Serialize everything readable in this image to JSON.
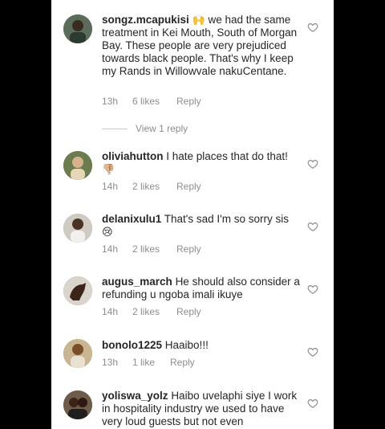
{
  "comments": [
    {
      "username": "songz.mcapukisi",
      "emoji": "🙌",
      "text": "we had the same treatment in Kei Mouth, South of Morgan Bay. These people are very prejudiced towards black people. That's why I keep my Rands in Willowvale nakuCentane.",
      "time": "13h",
      "likes": "6 likes",
      "reply": "Reply"
    },
    {
      "username": "oliviahutton",
      "text": "I hate places that do that!",
      "emoji": "👎🏼",
      "time": "14h",
      "likes": "2 likes",
      "reply": "Reply"
    },
    {
      "username": "delanixulu1",
      "text": "That's sad I'm so sorry sis",
      "emoji": "😢",
      "time": "14h",
      "likes": "2 likes",
      "reply": "Reply"
    },
    {
      "username": "augus_march",
      "text": "He should also consider a refunding u ngoba imali ikuye",
      "time": "14h",
      "likes": "2 likes",
      "reply": "Reply"
    },
    {
      "username": "bonolo1225",
      "text": "Haaibo!!!",
      "time": "13h",
      "likes": "1 like",
      "reply": "Reply"
    },
    {
      "username": "yoliswa_yolz",
      "text": "Haibo uvelaphi siye I work in hospitality industry we used to have very loud guests but not even"
    }
  ],
  "view_replies": "View 1 reply",
  "icons": {
    "like": "heart-outline-icon"
  },
  "colors": {
    "text": "#262626",
    "muted": "#8e8e8e",
    "background": "#ffffff",
    "outer": "#000000"
  }
}
